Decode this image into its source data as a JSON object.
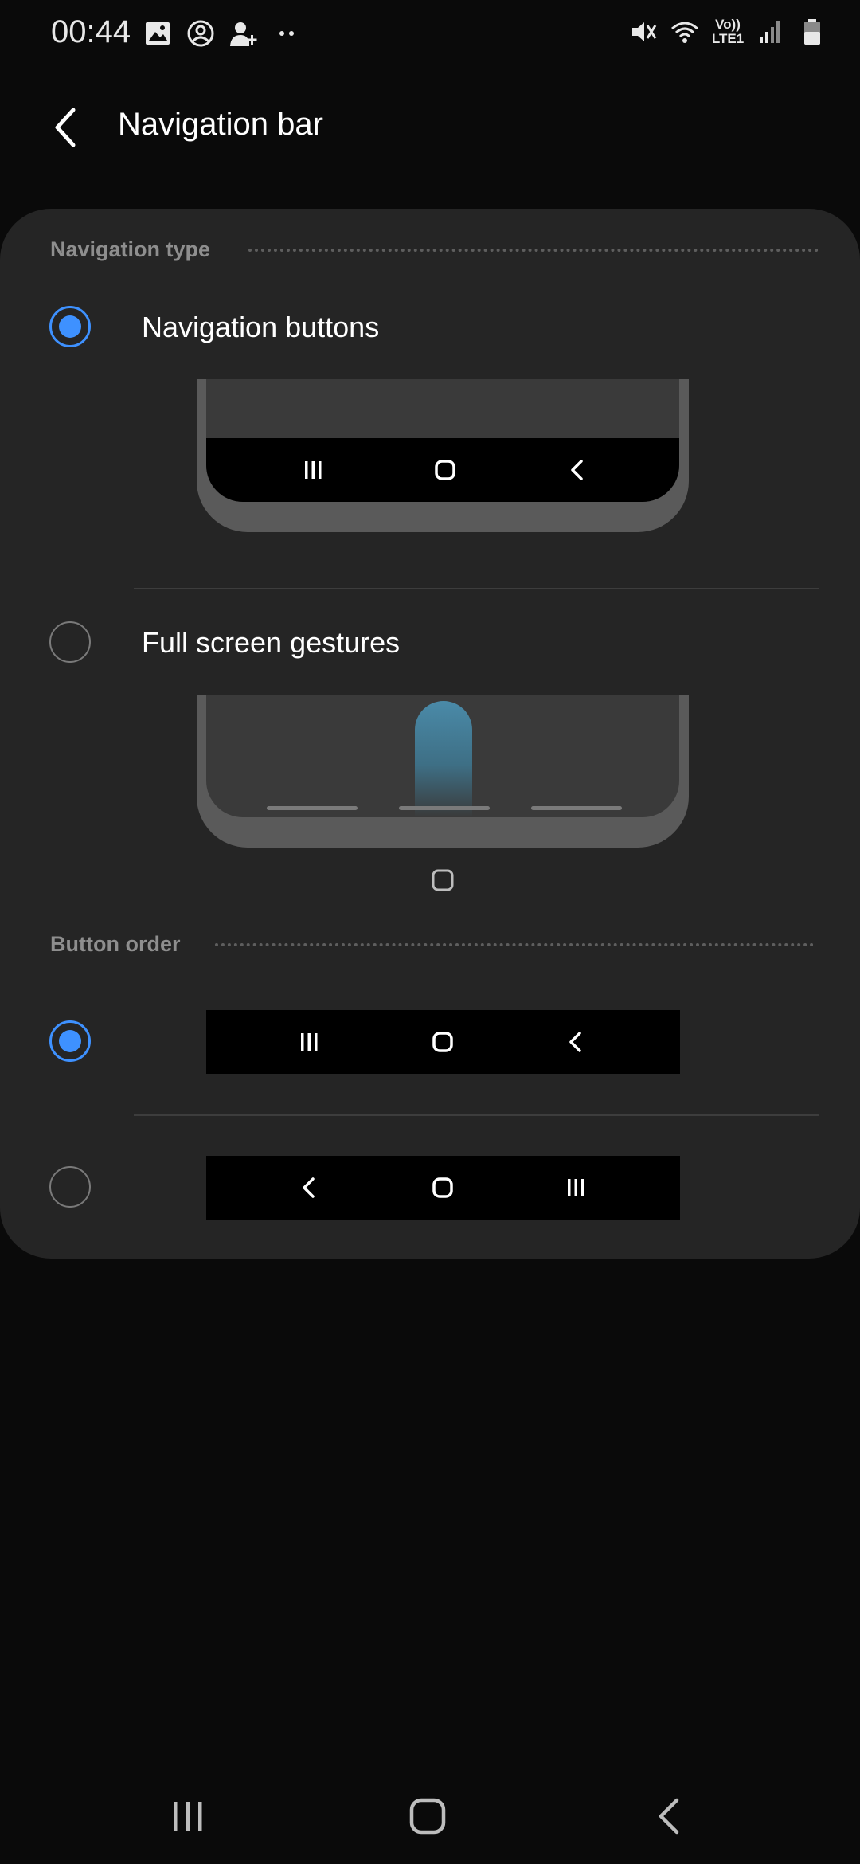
{
  "status_bar": {
    "time": "00:44",
    "left_icons": [
      "image-icon",
      "account-circle-icon",
      "person-add-icon",
      "more-dots-icon"
    ],
    "right_icons": [
      "mute-icon",
      "wifi-icon",
      "volte-lte-icon",
      "signal-icon",
      "battery-icon"
    ],
    "volte_label": "Vo))",
    "lte_label": "LTE1"
  },
  "app_bar": {
    "title": "Navigation bar"
  },
  "navigation_type": {
    "header": "Navigation type",
    "options": [
      {
        "label": "Navigation buttons",
        "selected": true
      },
      {
        "label": "Full screen gestures",
        "selected": false
      }
    ]
  },
  "button_order": {
    "header": "Button order",
    "options": [
      {
        "order": [
          "recents-icon",
          "home-icon",
          "back-icon"
        ],
        "selected": true
      },
      {
        "order": [
          "back-icon",
          "home-icon",
          "recents-icon"
        ],
        "selected": false
      }
    ]
  },
  "colors": {
    "accent": "#3e91ff",
    "card_bg": "#252525",
    "page_bg": "#0a0a0a"
  },
  "system_nav": {
    "icons": [
      "recents-icon",
      "home-icon",
      "back-icon"
    ]
  }
}
